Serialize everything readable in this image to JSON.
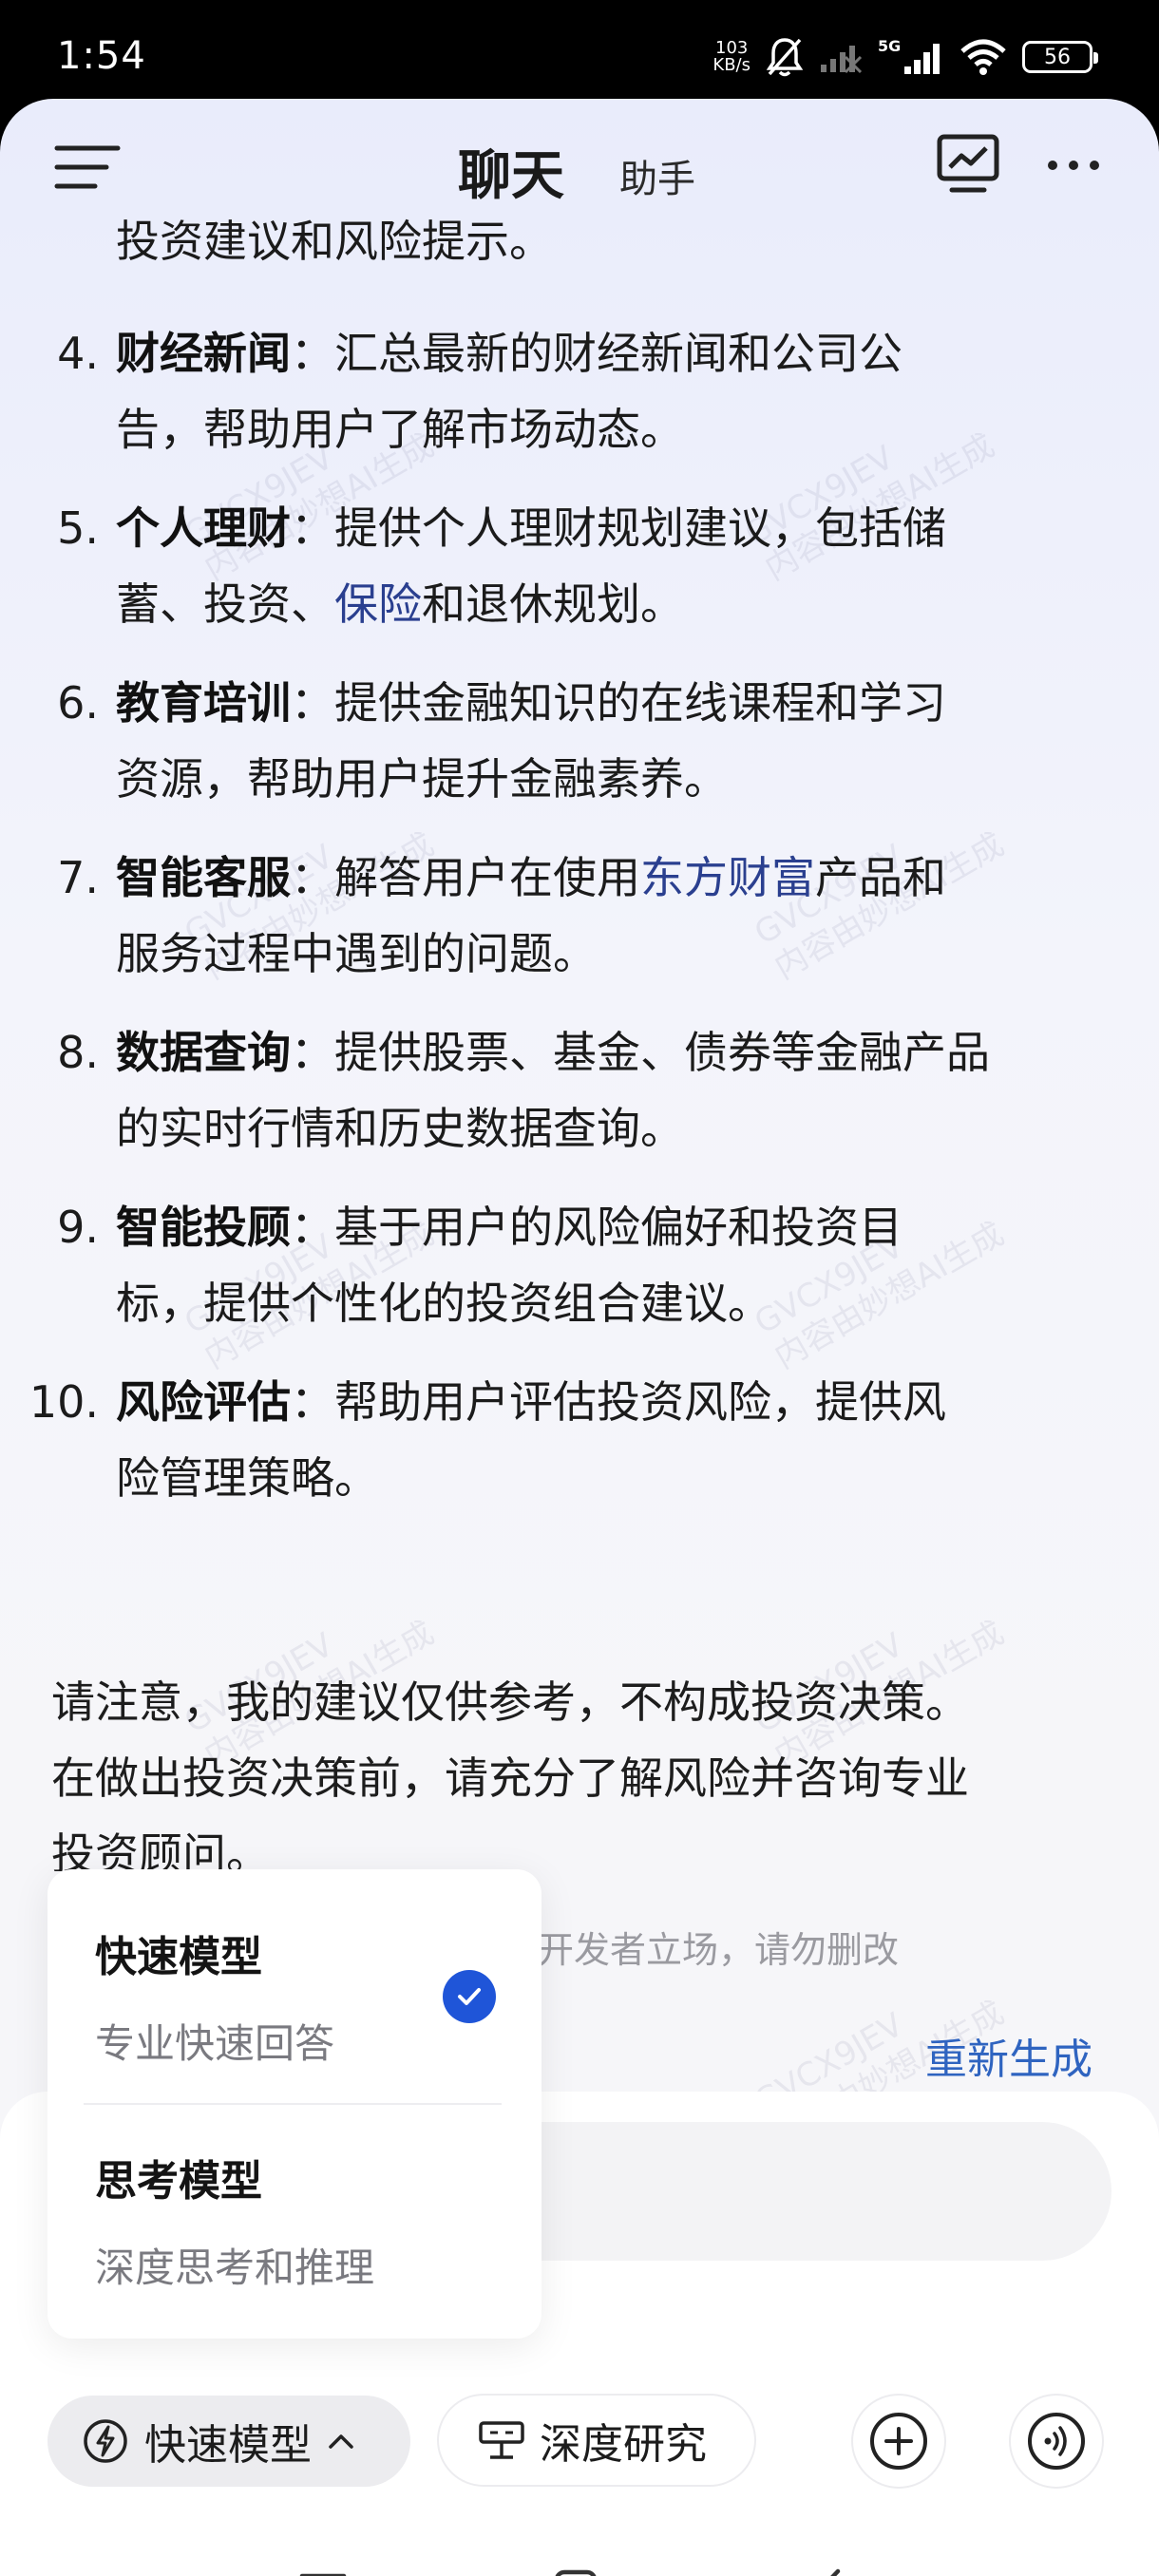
{
  "status_bar": {
    "time": "1:54",
    "net_speed_value": "103",
    "net_speed_unit": "KB/s",
    "network": "5G",
    "battery": "56"
  },
  "header": {
    "title": "聊天",
    "subtitle": "助手"
  },
  "chat": {
    "intro_tail": "投资建议和风险提示。",
    "items": [
      {
        "num": "4.",
        "title": "财经新闻",
        "line1": "：汇总最新的财经新闻和公司公",
        "line2": "告，帮助用户了解市场动态。"
      },
      {
        "num": "5.",
        "title": "个人理财",
        "line1": "：提供个人理财规划建议，包括储",
        "line2_pre": "蓄、投资、",
        "line2_link": "保险",
        "line2_post": "和退休规划。"
      },
      {
        "num": "6.",
        "title": "教育培训",
        "line1": "：提供金融知识的在线课程和学习",
        "line2": "资源，帮助用户提升金融素养。"
      },
      {
        "num": "7.",
        "title": "智能客服",
        "line1_pre": "：解答用户在使用",
        "line1_link": "东方财富",
        "line1_post": "产品和",
        "line2": "服务过程中遇到的问题。"
      },
      {
        "num": "8.",
        "title": "数据查询",
        "line1": "：提供股票、基金、债券等金融产品",
        "line2": "的实时行情和历史数据查询。"
      },
      {
        "num": "9.",
        "title": "智能投顾",
        "line1": "：基于用户的风险偏好和投资目",
        "line2": "标，提供个性化的投资组合建议。"
      },
      {
        "num": "10.",
        "title": "风险评估",
        "line1": "：帮助用户评估投资风险，提供风",
        "line2": "险管理策略。"
      }
    ],
    "note_line1": "请注意，我的建议仅供参考，不构成投资决策。",
    "note_line2": "在做出投资决策前，请充分了解风险并咨询专业",
    "note_line3": "投资顾问。",
    "disclaimer": "开发者立场，请勿删改",
    "regenerate": "重新生成",
    "watermark": [
      "GVCX9JEV",
      "内容由妙想AI生成"
    ]
  },
  "model_menu": {
    "options": [
      {
        "title": "快速模型",
        "desc": "专业快速回答",
        "selected": true
      },
      {
        "title": "思考模型",
        "desc": "深度思考和推理",
        "selected": false
      }
    ]
  },
  "toolbar": {
    "model_chip": "快速模型",
    "deep_research": "深度研究"
  },
  "colors": {
    "accent": "#1f55d8",
    "link": "#2a3f8f",
    "regen": "#2f64c0"
  }
}
